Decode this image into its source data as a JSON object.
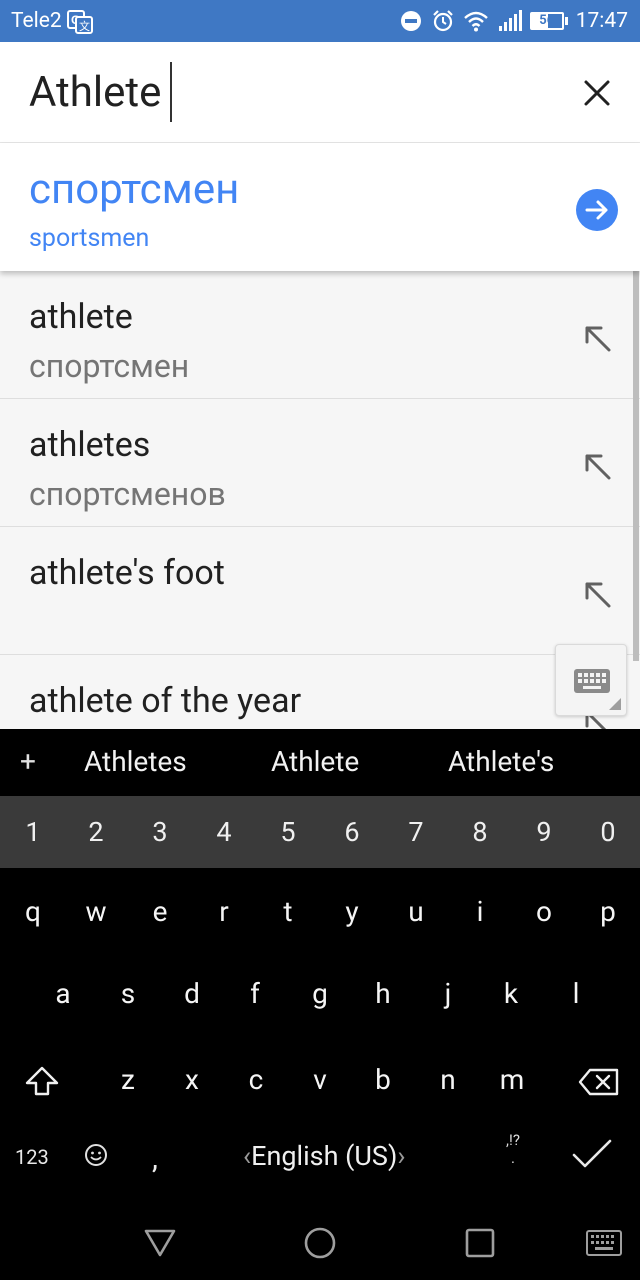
{
  "status_bar": {
    "carrier": "Tele2",
    "battery": "56",
    "time": "17:47"
  },
  "search": {
    "query": "Athlete"
  },
  "result": {
    "translation": "спортсмен",
    "transliteration": "sportsmen"
  },
  "suggestions": [
    {
      "word": "athlete",
      "translation": "спортсмен"
    },
    {
      "word": "athletes",
      "translation": "спортсменов"
    },
    {
      "word": "athlete's foot",
      "translation": ""
    },
    {
      "word": "athlete of the year",
      "translation": ""
    }
  ],
  "keyboard": {
    "predictions": [
      "Athletes",
      "Athlete",
      "Athlete's"
    ],
    "number_row": [
      "1",
      "2",
      "3",
      "4",
      "5",
      "6",
      "7",
      "8",
      "9",
      "0"
    ],
    "row1": [
      "q",
      "w",
      "e",
      "r",
      "t",
      "y",
      "u",
      "i",
      "o",
      "p"
    ],
    "row2": [
      "a",
      "s",
      "d",
      "f",
      "g",
      "h",
      "j",
      "k",
      "l"
    ],
    "row3": [
      "z",
      "x",
      "c",
      "v",
      "b",
      "n",
      "m"
    ],
    "mode_key": "123",
    "comma_key": ",",
    "language": "English (US)",
    "punct_key": ",!?",
    "punct_dot": "."
  },
  "colors": {
    "status_bar": "#3f78c4",
    "accent_blue": "#4285f4"
  }
}
